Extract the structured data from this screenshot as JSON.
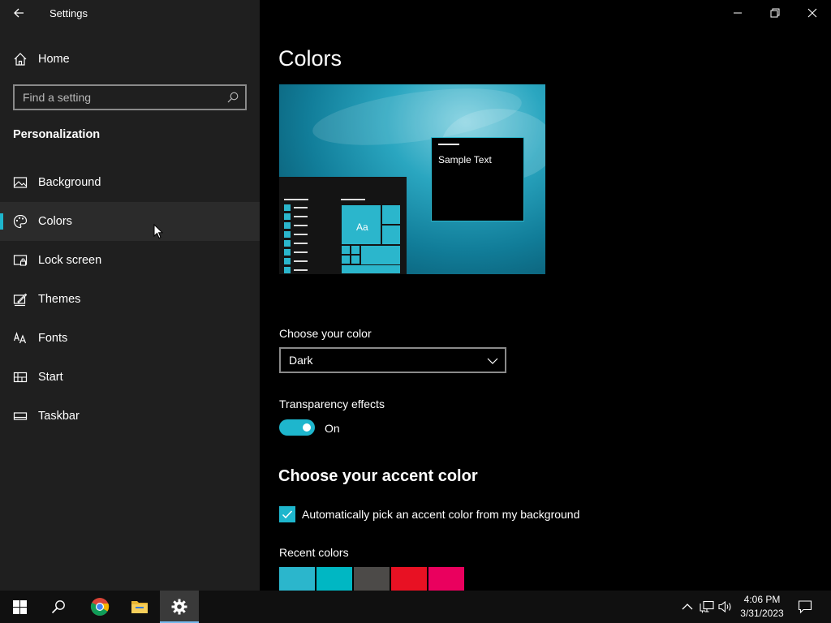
{
  "window": {
    "title": "Settings"
  },
  "sidebar": {
    "home_label": "Home",
    "search_placeholder": "Find a setting",
    "section_heading": "Personalization",
    "items": [
      {
        "label": "Background",
        "icon": "picture-icon"
      },
      {
        "label": "Colors",
        "icon": "palette-icon",
        "selected": true
      },
      {
        "label": "Lock screen",
        "icon": "lock-screen-icon"
      },
      {
        "label": "Themes",
        "icon": "themes-icon"
      },
      {
        "label": "Fonts",
        "icon": "fonts-icon"
      },
      {
        "label": "Start",
        "icon": "start-icon"
      },
      {
        "label": "Taskbar",
        "icon": "taskbar-icon"
      }
    ]
  },
  "main": {
    "title": "Colors",
    "preview": {
      "tile_text": "Aa",
      "sample_text": "Sample Text"
    },
    "choose_color": {
      "label": "Choose your color",
      "value": "Dark"
    },
    "transparency": {
      "label": "Transparency effects",
      "state": "On",
      "enabled": true
    },
    "accent_heading": "Choose your accent color",
    "auto_accent": {
      "label": "Automatically pick an accent color from my background",
      "checked": true
    },
    "recent_colors": {
      "label": "Recent colors",
      "colors": [
        "#2bb6cc",
        "#00b7c3",
        "#4c4a48",
        "#e81123",
        "#ea005e"
      ]
    }
  },
  "taskbar": {
    "time": "4:06 PM",
    "date": "3/31/2023"
  },
  "colors": {
    "accent": "#1eb6cd",
    "sidebar_bg": "#1f1f1f",
    "main_bg": "#000000"
  }
}
